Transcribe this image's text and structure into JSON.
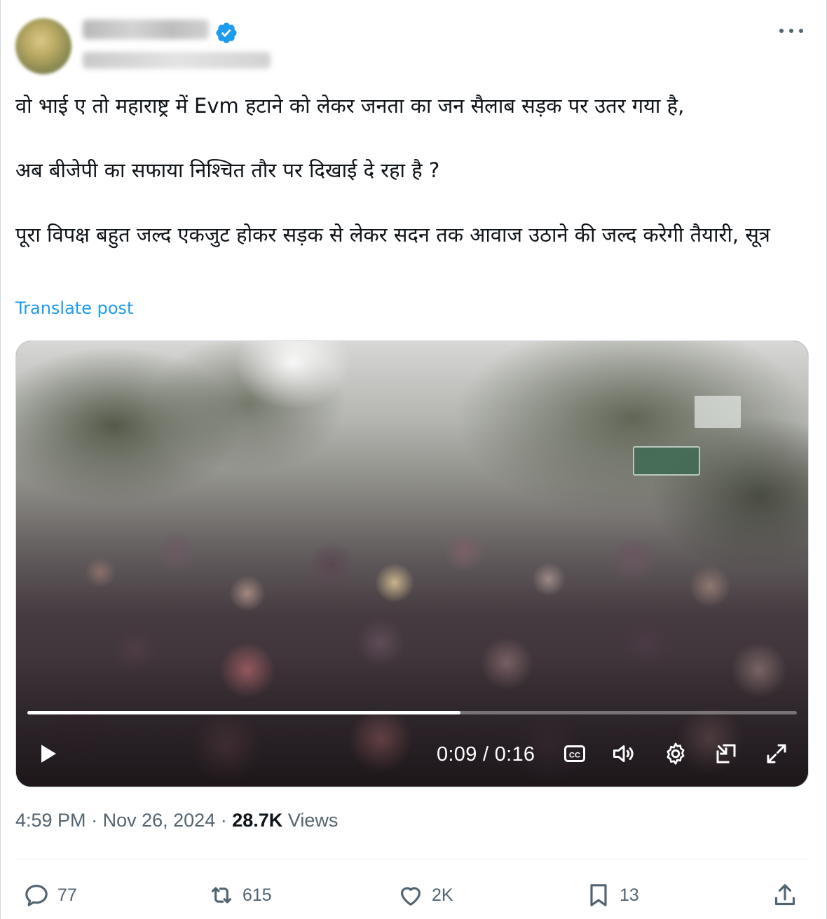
{
  "author": {
    "avatar_icon": "avatar",
    "verified_icon": "verified-badge-icon"
  },
  "post": {
    "paragraphs": [
      "वो भाई ए तो महाराष्ट्र में Evm हटाने को लेकर जनता का जन सैलाब सड़क पर उतर गया है,",
      "अब बीजेपी का सफाया निश्चित तौर पर दिखाई दे रहा है ?",
      "पूरा विपक्ष बहुत जल्द एकजुट होकर सड़क से लेकर सदन तक आवाज उठाने की जल्द करेगी तैयारी, सूत्र"
    ],
    "translate_label": "Translate post"
  },
  "video": {
    "time_display": "0:09 / 0:16",
    "progress_fraction": 0.5625,
    "icons": [
      "play-icon",
      "captions-icon",
      "volume-icon",
      "settings-icon",
      "pip-icon",
      "fullscreen-icon"
    ]
  },
  "meta": {
    "time": "4:59 PM",
    "separator": "·",
    "date": "Nov 26, 2024",
    "views_count": "28.7K",
    "views_label": "Views"
  },
  "actions": {
    "replies": "77",
    "reposts": "615",
    "likes": "2K",
    "bookmarks": "13"
  },
  "colors": {
    "accent": "#1d9bf0",
    "muted": "#536471",
    "text": "#0f1419"
  }
}
